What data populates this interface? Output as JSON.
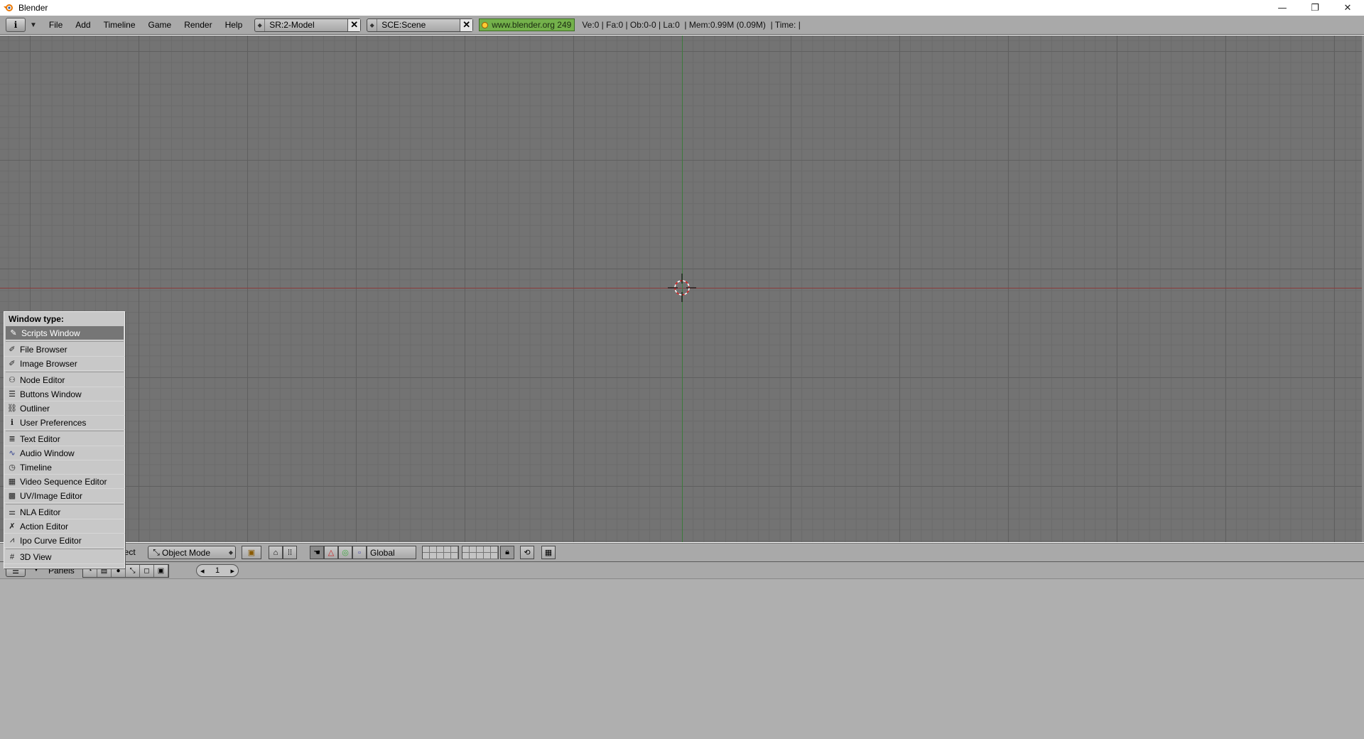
{
  "window": {
    "title": "Blender",
    "minimize": "—",
    "restore": "❐",
    "close": "✕"
  },
  "info_header": {
    "menus": [
      "File",
      "Add",
      "Timeline",
      "Game",
      "Render",
      "Help"
    ],
    "screen_field": "SR:2-Model",
    "scene_field": "SCE:Scene",
    "url": "www.blender.org 249",
    "stats": "Ve:0 | Fa:0 | Ob:0-0 | La:0  | Mem:0.99M (0.09M)  | Time: |"
  },
  "view3d_header": {
    "mode_label_partial": "ject",
    "mode": "Object Mode",
    "orientation": "Global"
  },
  "buttons_header": {
    "panels_label": "Panels",
    "frame": "1"
  },
  "popup": {
    "title": "Window type:",
    "items": [
      {
        "label": "Scripts Window",
        "icon": "scripts-icon"
      },
      {
        "label": "File Browser",
        "icon": "file-browser-icon"
      },
      {
        "label": "Image Browser",
        "icon": "image-browser-icon"
      },
      {
        "label": "Node Editor",
        "icon": "node-editor-icon"
      },
      {
        "label": "Buttons Window",
        "icon": "buttons-window-icon"
      },
      {
        "label": "Outliner",
        "icon": "outliner-icon"
      },
      {
        "label": "User Preferences",
        "icon": "info-icon"
      },
      {
        "label": "Text Editor",
        "icon": "text-editor-icon"
      },
      {
        "label": "Audio Window",
        "icon": "audio-icon"
      },
      {
        "label": "Timeline",
        "icon": "timeline-icon"
      },
      {
        "label": "Video Sequence Editor",
        "icon": "sequence-icon"
      },
      {
        "label": "UV/Image Editor",
        "icon": "uv-image-icon"
      },
      {
        "label": "NLA Editor",
        "icon": "nla-icon"
      },
      {
        "label": "Action Editor",
        "icon": "action-icon"
      },
      {
        "label": "Ipo Curve Editor",
        "icon": "ipo-icon"
      },
      {
        "label": "3D View",
        "icon": "3d-view-icon"
      }
    ]
  }
}
